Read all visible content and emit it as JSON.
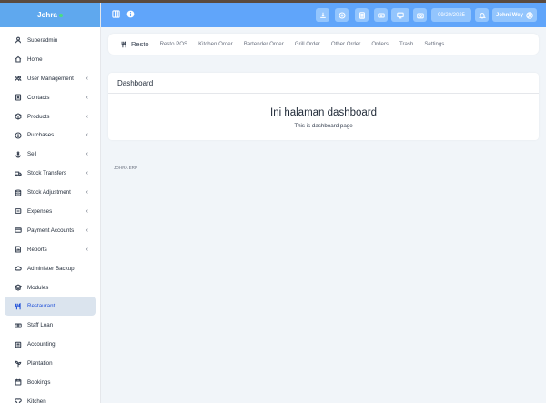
{
  "sidebar": {
    "brand": "Johra",
    "items": [
      {
        "label": "Superadmin",
        "icon": "settings-icon",
        "chevron": false
      },
      {
        "label": "Home",
        "icon": "home-icon",
        "chevron": false
      },
      {
        "label": "User Management",
        "icon": "users-icon",
        "chevron": true
      },
      {
        "label": "Contacts",
        "icon": "address-book-icon",
        "chevron": true
      },
      {
        "label": "Products",
        "icon": "box-icon",
        "chevron": true
      },
      {
        "label": "Purchases",
        "icon": "download-icon",
        "chevron": true
      },
      {
        "label": "Sell",
        "icon": "anchor-icon",
        "chevron": true
      },
      {
        "label": "Stock Transfers",
        "icon": "truck-icon",
        "chevron": true
      },
      {
        "label": "Stock Adjustment",
        "icon": "database-icon",
        "chevron": true
      },
      {
        "label": "Expenses",
        "icon": "minus-circle-icon",
        "chevron": true
      },
      {
        "label": "Payment Accounts",
        "icon": "credit-card-icon",
        "chevron": true
      },
      {
        "label": "Reports",
        "icon": "chart-icon",
        "chevron": true
      },
      {
        "label": "Administer Backup",
        "icon": "cloud-icon",
        "chevron": false
      },
      {
        "label": "Modules",
        "icon": "layers-icon",
        "chevron": false
      },
      {
        "label": "Restaurant",
        "icon": "utensils-icon",
        "chevron": false,
        "active": true
      },
      {
        "label": "Staff Loan",
        "icon": "money-icon",
        "chevron": false
      },
      {
        "label": "Accounting",
        "icon": "calculator-icon",
        "chevron": false
      },
      {
        "label": "Plantation",
        "icon": "plant-icon",
        "chevron": false
      },
      {
        "label": "Bookings",
        "icon": "calendar-icon",
        "chevron": false
      },
      {
        "label": "Kitchen",
        "icon": "chef-icon",
        "chevron": false
      }
    ]
  },
  "header": {
    "date": "09/20/2025",
    "user": "Johni Wey",
    "buttons": [
      "download-icon",
      "plus-circle-icon",
      "calculator-icon",
      "keyboard-icon",
      "monitor-icon",
      "camera-icon"
    ]
  },
  "subnav": {
    "title": "Resto",
    "links": [
      "Resto POS",
      "Kitchen Order",
      "Bartender Order",
      "Grill Order",
      "Other Order",
      "Orders",
      "Trash",
      "Settings"
    ]
  },
  "card": {
    "heading": "Dashboard",
    "big_text": "Ini halaman dashboard",
    "small_text": "This is dashboard page"
  },
  "footer": {
    "brand": "JOHRA ERP"
  },
  "colors": {
    "header": "#60a5fa",
    "brand": "#5fa8ee",
    "active_bg": "#dbe4ee",
    "active_text": "#1d4ed8",
    "page_bg": "#f1f5f9"
  }
}
